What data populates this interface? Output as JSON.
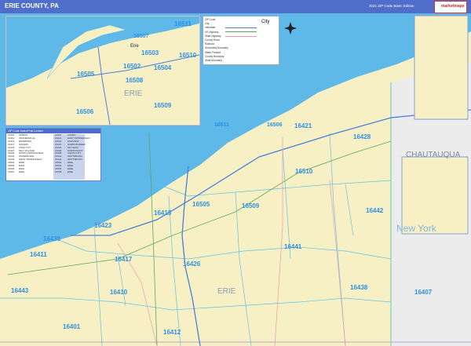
{
  "header": {
    "title": "ERIE COUNTY, PA",
    "edition": "2021 ZIP Code Basic Edition",
    "logo_text": "marketmaps"
  },
  "colors": {
    "water": "#5eb8e8",
    "land": "#f7f0c4",
    "neighbor": "#e8e8e8",
    "zip_label": "#2d8fe6",
    "header_bar": "#4f6ec9"
  },
  "map": {
    "county_label": "ERIE",
    "inset_county_label": "ERIE",
    "neighbor_county": "CHAUTAUQUA",
    "state_label": "New York",
    "inset_city": "Erie",
    "compass": "north-compass",
    "main_zips": [
      "16421",
      "16428",
      "16510",
      "16505",
      "16509",
      "16442",
      "16415",
      "16423",
      "16441",
      "16417",
      "16426",
      "16438",
      "16411",
      "16443",
      "16410",
      "16407",
      "16401",
      "16412",
      "16430",
      "16511",
      "16506"
    ],
    "inset_zips": [
      "16511",
      "16507",
      "16503",
      "16510",
      "16502",
      "16504",
      "16505",
      "16508",
      "16509",
      "16506"
    ]
  },
  "legend": {
    "rows": [
      "ZIP Code",
      "City",
      "Interstate",
      "US Highway",
      "State Highway",
      "County Road",
      "Railroad",
      "Secondary Boundary",
      "Water Feature",
      "County Boundary",
      "State Boundary"
    ],
    "city_label": "City"
  },
  "index_table": {
    "title": "ZIP Code Index/Post Locator",
    "rows": [
      [
        "16401",
        "ALBION",
        "16407",
        "CORRY"
      ],
      [
        "16410",
        "CRANESVILLE",
        "16411",
        "EAST SPRINGFIELD"
      ],
      [
        "16412",
        "EDINBORO",
        "16415",
        "FAIRVIEW"
      ],
      [
        "16417",
        "GIRARD",
        "16421",
        "HARBORCREEK"
      ],
      [
        "16423",
        "LAKE CITY",
        "16426",
        "MC KEAN"
      ],
      [
        "16427",
        "MILL VILLAGE",
        "16428",
        "NORTH EAST"
      ],
      [
        "16430",
        "NORTH SPRINGFIELD",
        "16438",
        "UNION CITY"
      ],
      [
        "16441",
        "WATERFORD",
        "16442",
        "WATTSBURG"
      ],
      [
        "16443",
        "WEST SPRINGFIELD",
        "16444",
        "WATTSBURG"
      ],
      [
        "16501",
        "ERIE",
        "16502",
        "ERIE"
      ],
      [
        "16503",
        "ERIE",
        "16504",
        "ERIE"
      ],
      [
        "16505",
        "ERIE",
        "16506",
        "ERIE"
      ],
      [
        "16507",
        "ERIE",
        "16508",
        "ERIE"
      ]
    ]
  }
}
